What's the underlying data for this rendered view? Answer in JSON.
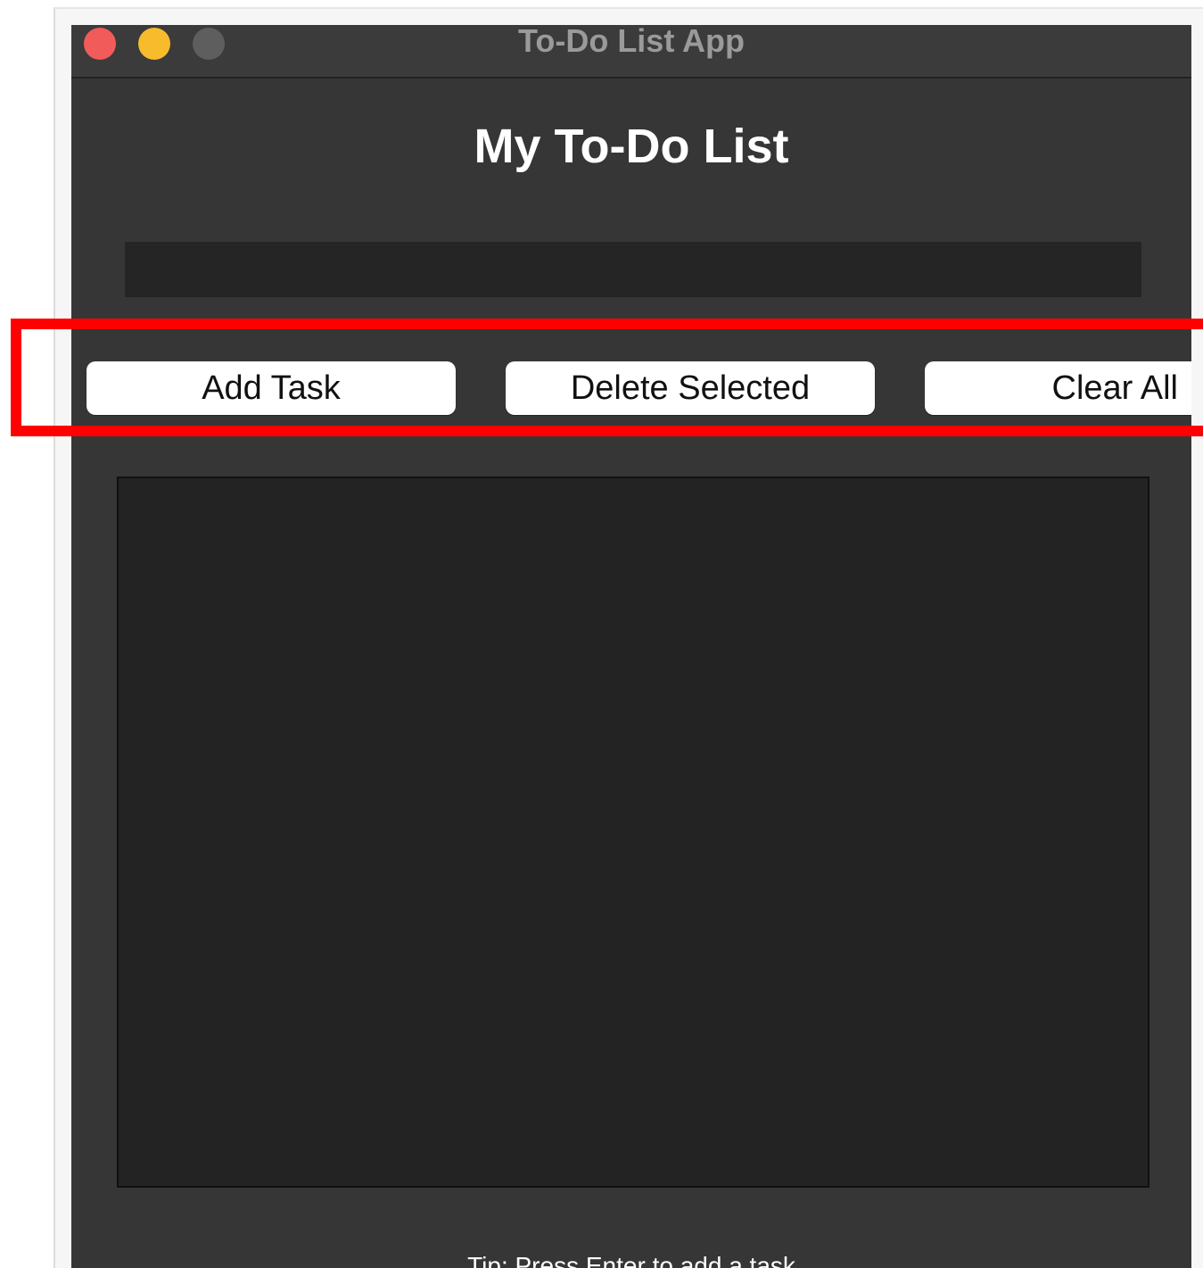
{
  "window": {
    "title": "To-Do List App"
  },
  "app": {
    "heading": "My To-Do List",
    "input_value": "",
    "tip": "Tip: Press Enter to add a task"
  },
  "buttons": {
    "add_task": "Add Task",
    "delete_selected": "Delete Selected",
    "clear_all": "Clear All"
  },
  "tasks": [],
  "colors": {
    "window_bg": "#363636",
    "input_bg": "#252525",
    "list_bg": "#232323",
    "button_bg": "#ffffff",
    "close": "#f15b5a",
    "minimize": "#f8bb2c",
    "zoom": "#5e5e5e",
    "highlight": "#ff0000"
  },
  "icons": [
    "close-traffic-light-icon",
    "minimize-traffic-light-icon",
    "zoom-traffic-light-icon"
  ]
}
